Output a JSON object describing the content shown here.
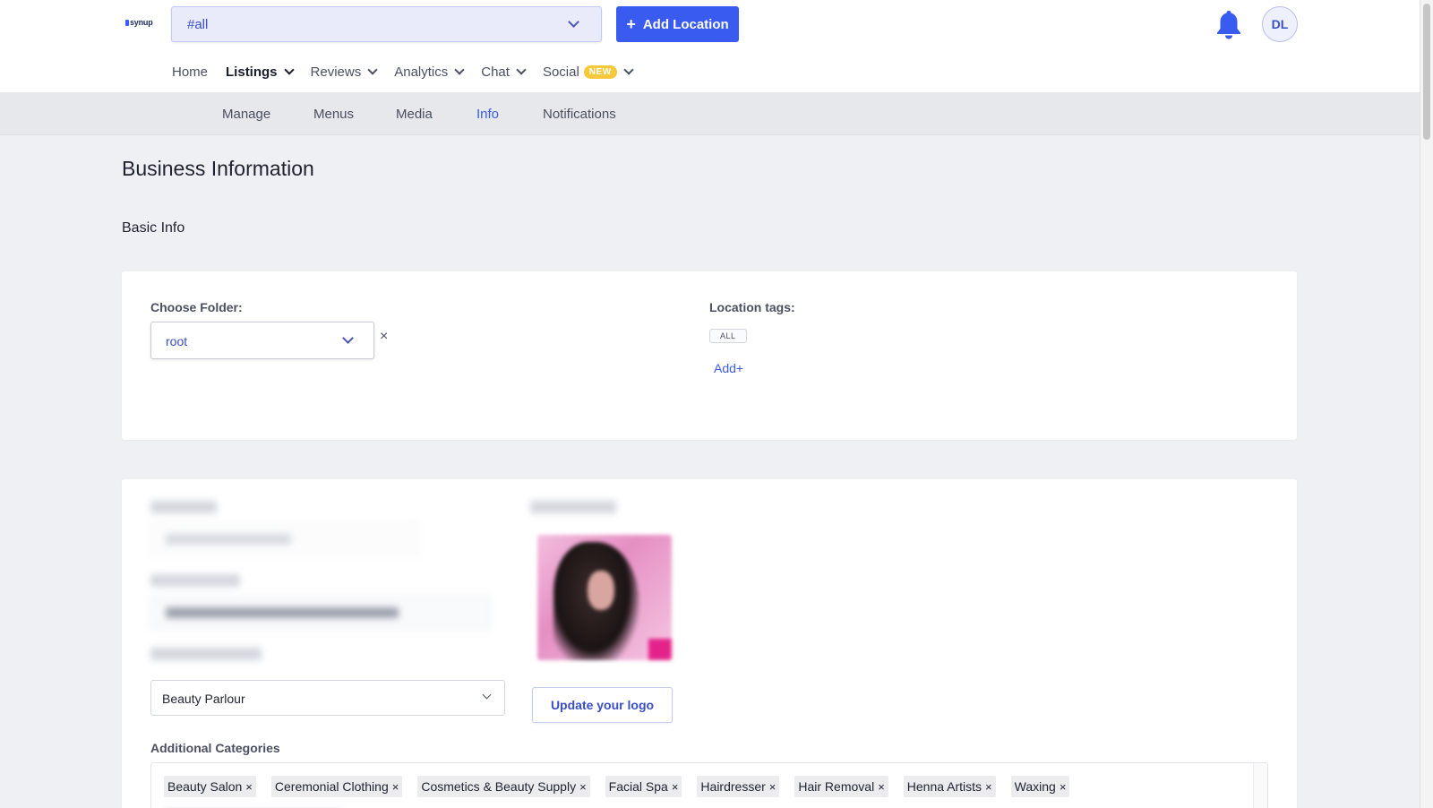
{
  "header": {
    "logo_text": "synup",
    "location_select": "#all",
    "add_location_label": "Add Location",
    "avatar_initials": "DL"
  },
  "main_nav": [
    {
      "label": "Home",
      "dropdown": false,
      "active": false
    },
    {
      "label": "Listings",
      "dropdown": true,
      "active": true
    },
    {
      "label": "Reviews",
      "dropdown": true,
      "active": false
    },
    {
      "label": "Analytics",
      "dropdown": true,
      "active": false
    },
    {
      "label": "Chat",
      "dropdown": true,
      "active": false
    },
    {
      "label": "Social",
      "dropdown": true,
      "active": false,
      "badge": "NEW"
    }
  ],
  "sub_nav": [
    {
      "label": "Manage",
      "active": false
    },
    {
      "label": "Menus",
      "active": false
    },
    {
      "label": "Media",
      "active": false
    },
    {
      "label": "Info",
      "active": true
    },
    {
      "label": "Notifications",
      "active": false
    }
  ],
  "page": {
    "title": "Business Information",
    "section_title": "Basic Info"
  },
  "folder_card": {
    "choose_folder_label": "Choose Folder:",
    "folder_value": "root",
    "clear_icon": "×",
    "location_tags_label": "Location tags:",
    "tag": "ALL",
    "add_tag_label": "Add+"
  },
  "business_card": {
    "primary_category": "Beauty Parlour",
    "update_logo_label": "Update your logo",
    "additional_categories_label": "Additional Categories",
    "additional_categories": [
      "Beauty Salon",
      "Ceremonial Clothing",
      "Cosmetics & Beauty Supply",
      "Facial Spa",
      "Hairdresser",
      "Hair Removal",
      "Henna Artists",
      "Waxing"
    ],
    "chip_remove": "×"
  },
  "colors": {
    "accent": "#3a5bf0",
    "badge_new": "#f7c93a",
    "page_bg": "#eef0f3"
  }
}
